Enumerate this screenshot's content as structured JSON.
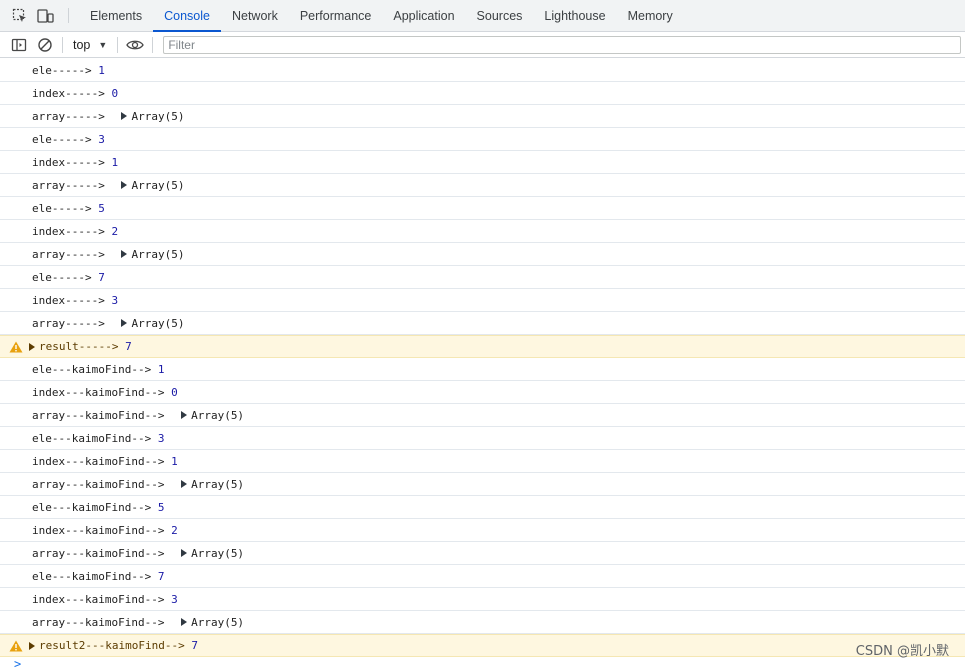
{
  "tabs": [
    {
      "label": "Elements"
    },
    {
      "label": "Console",
      "active": true
    },
    {
      "label": "Network"
    },
    {
      "label": "Performance"
    },
    {
      "label": "Application"
    },
    {
      "label": "Sources"
    },
    {
      "label": "Lighthouse"
    },
    {
      "label": "Memory"
    }
  ],
  "toolbar": {
    "context": "top",
    "filter_placeholder": "Filter"
  },
  "colors": {
    "accent": "#0b57d0",
    "number": "#1a1aa6",
    "warning_bg": "#fef7e0",
    "warning_icon": "#e8a10e"
  },
  "logs": [
    {
      "label": "ele-----> ",
      "value": "1"
    },
    {
      "label": "index-----> ",
      "value": "0"
    },
    {
      "label": "array-----> ",
      "object": "Array(5)"
    },
    {
      "label": "ele-----> ",
      "value": "3"
    },
    {
      "label": "index-----> ",
      "value": "1"
    },
    {
      "label": "array-----> ",
      "object": "Array(5)"
    },
    {
      "label": "ele-----> ",
      "value": "5"
    },
    {
      "label": "index-----> ",
      "value": "2"
    },
    {
      "label": "array-----> ",
      "object": "Array(5)"
    },
    {
      "label": "ele-----> ",
      "value": "7"
    },
    {
      "label": "index-----> ",
      "value": "3"
    },
    {
      "label": "array-----> ",
      "object": "Array(5)"
    },
    {
      "label": "result-----> ",
      "value": "7",
      "warn": true
    },
    {
      "label": "ele---kaimoFind--> ",
      "value": "1"
    },
    {
      "label": "index---kaimoFind--> ",
      "value": "0"
    },
    {
      "label": "array---kaimoFind--> ",
      "object": "Array(5)"
    },
    {
      "label": "ele---kaimoFind--> ",
      "value": "3"
    },
    {
      "label": "index---kaimoFind--> ",
      "value": "1"
    },
    {
      "label": "array---kaimoFind--> ",
      "object": "Array(5)"
    },
    {
      "label": "ele---kaimoFind--> ",
      "value": "5"
    },
    {
      "label": "index---kaimoFind--> ",
      "value": "2"
    },
    {
      "label": "array---kaimoFind--> ",
      "object": "Array(5)"
    },
    {
      "label": "ele---kaimoFind--> ",
      "value": "7"
    },
    {
      "label": "index---kaimoFind--> ",
      "value": "3"
    },
    {
      "label": "array---kaimoFind--> ",
      "object": "Array(5)"
    },
    {
      "label": "result2---kaimoFind--> ",
      "value": "7",
      "warn": true
    }
  ],
  "prompt": ">",
  "watermark": "CSDN @凯小默"
}
